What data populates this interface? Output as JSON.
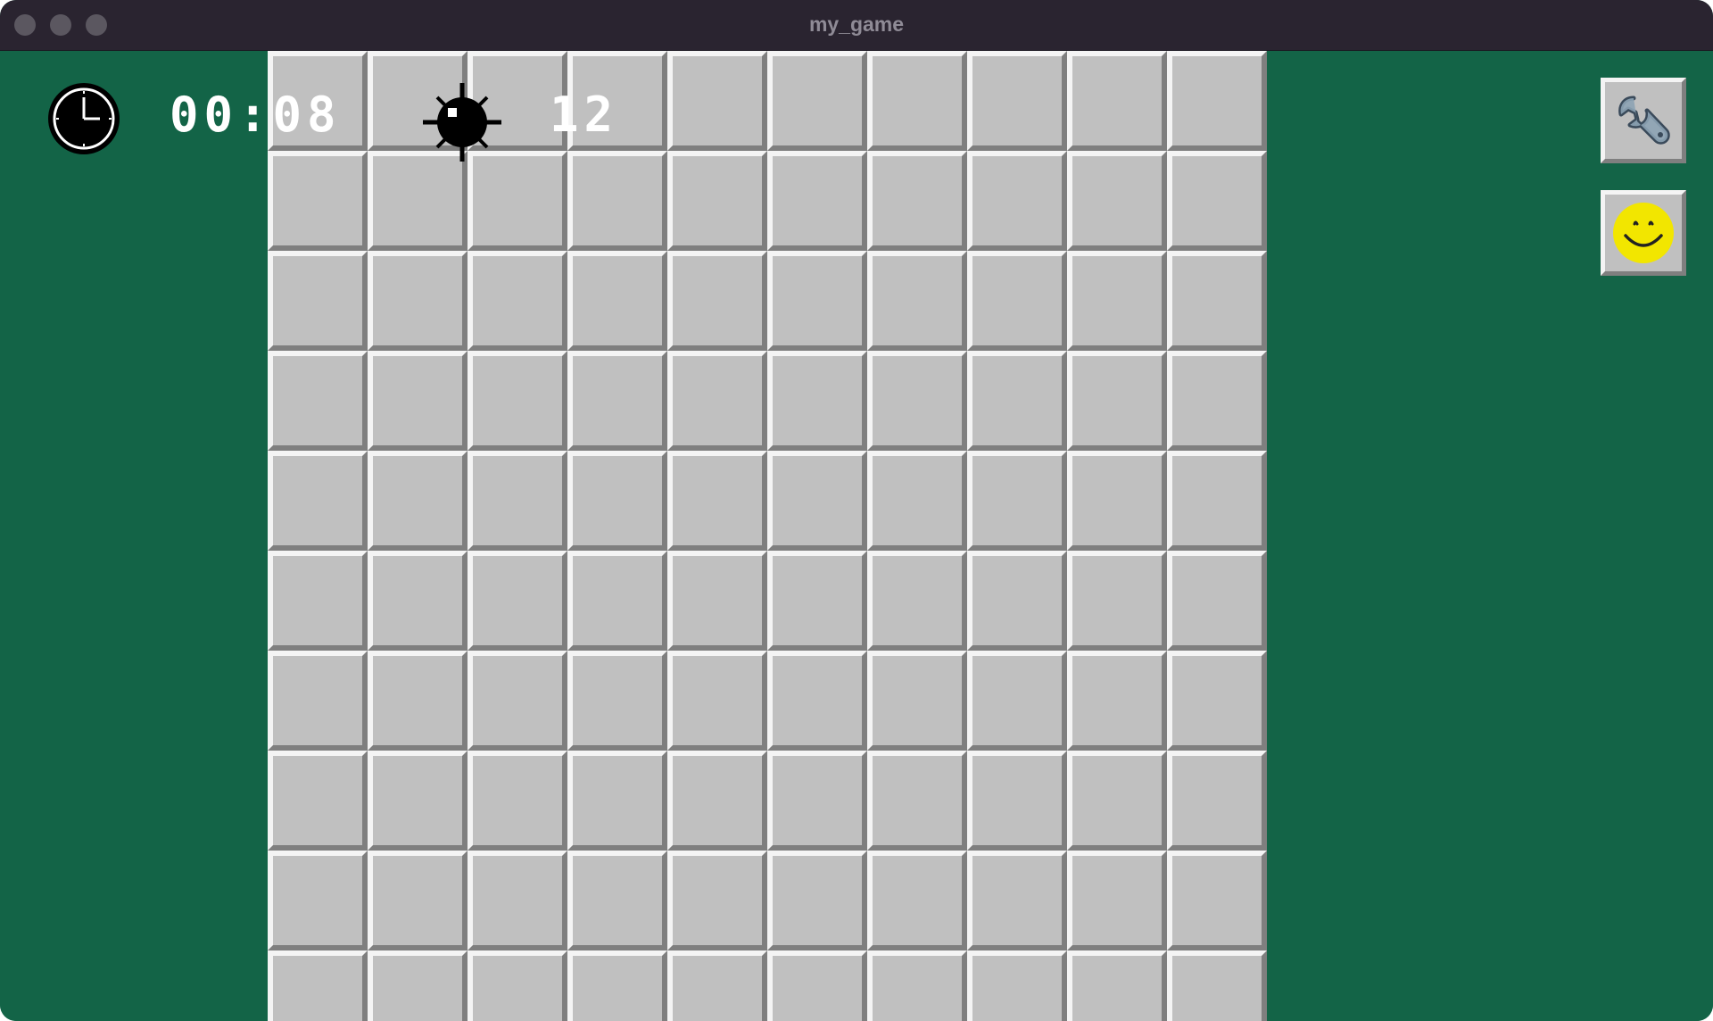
{
  "window": {
    "title": "my_game"
  },
  "hud": {
    "timer": "00:08",
    "mines_remaining": "12",
    "clock_icon": "clock-icon",
    "mine_icon": "mine-icon"
  },
  "toolbar": {
    "settings_icon": "wrench-icon",
    "reset_icon": "smiley-face-icon"
  },
  "board": {
    "columns": 10,
    "visible_rows": 10,
    "cell_state": "unrevealed"
  },
  "colors": {
    "background": "#136447",
    "titlebar": "#2a2430",
    "cell": "#c0c0c0",
    "cell_highlight": "#f4f4f4",
    "cell_shadow": "#7f7f7f",
    "smiley": "#f2e600"
  }
}
